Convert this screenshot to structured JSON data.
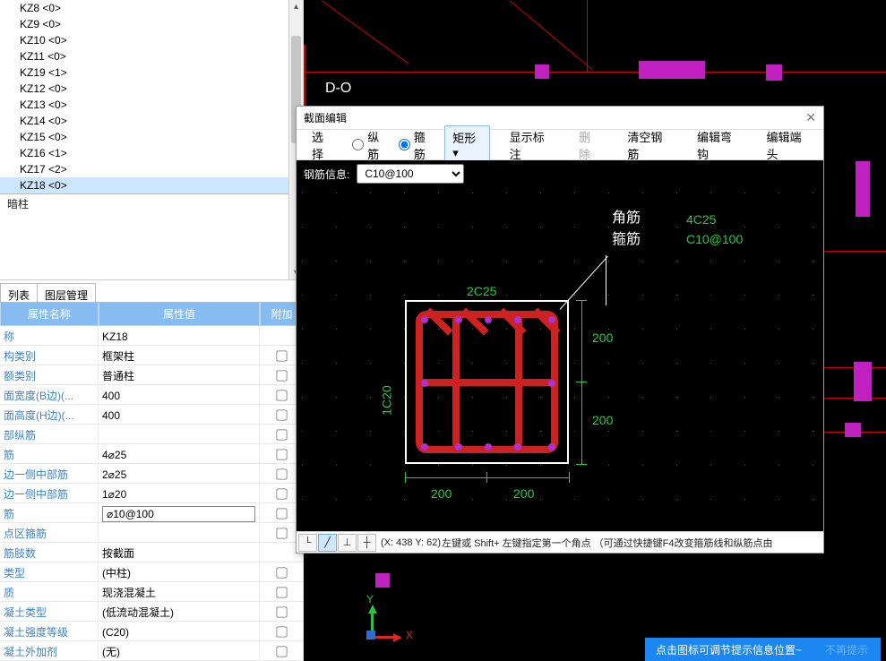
{
  "sidebar": {
    "items": [
      {
        "label": "KZ8  <0>"
      },
      {
        "label": "KZ9  <0>"
      },
      {
        "label": "KZ10  <0>"
      },
      {
        "label": "KZ11  <0>"
      },
      {
        "label": "KZ19  <1>"
      },
      {
        "label": "KZ12  <0>"
      },
      {
        "label": "KZ13  <0>"
      },
      {
        "label": "KZ14  <0>"
      },
      {
        "label": "KZ15  <0>"
      },
      {
        "label": "KZ16  <1>"
      },
      {
        "label": "KZ17  <2>"
      },
      {
        "label": "KZ18  <0>",
        "selected": true
      }
    ],
    "footer": "暗柱"
  },
  "tabs": {
    "t0": "列表",
    "t1": "图层管理"
  },
  "prop": {
    "head": {
      "c1": "属性名称",
      "c2": "属性值",
      "c3": "附加"
    },
    "rows": [
      {
        "n": "称",
        "v": "KZ18",
        "chk": false,
        "input": false
      },
      {
        "n": "构类别",
        "v": "框架柱",
        "chk": true
      },
      {
        "n": "额类别",
        "v": "普通柱",
        "chk": true
      },
      {
        "n": "面宽度(B边)(...",
        "v": "400",
        "chk": true
      },
      {
        "n": "面高度(H边)(...",
        "v": "400",
        "chk": true
      },
      {
        "n": "部纵筋",
        "v": "",
        "chk": true
      },
      {
        "n": "筋",
        "v": "4⌀25",
        "chk": true
      },
      {
        "n": "边一侧中部筋",
        "v": "2⌀25",
        "chk": true
      },
      {
        "n": "边一侧中部筋",
        "v": "1⌀20",
        "chk": true
      },
      {
        "n": "筋",
        "v": "⌀10@100",
        "chk": true,
        "input": true
      },
      {
        "n": "点区箍筋",
        "v": "",
        "chk": true
      },
      {
        "n": "筋肢数",
        "v": "按截面",
        "chk": false,
        "input": false
      },
      {
        "n": "类型",
        "v": "(中柱)",
        "chk": true
      },
      {
        "n": "质",
        "v": "现浇混凝土",
        "chk": true
      },
      {
        "n": "凝土类型",
        "v": "(低流动混凝土)",
        "chk": true
      },
      {
        "n": "凝土强度等级",
        "v": "(C20)",
        "chk": true
      },
      {
        "n": "凝土外加剂",
        "v": "(无)",
        "chk": true
      }
    ]
  },
  "canvas": {
    "axis_marker": "D-O",
    "axis_y": "Y",
    "axis_x": "X"
  },
  "tip": {
    "msg": "点击图标可调节提示信息位置~",
    "dismiss": "不再提示"
  },
  "modal": {
    "title": "截面编辑",
    "toolbar": {
      "select": "选择",
      "zong": "纵筋",
      "gu": "箍筋",
      "shape": "矩形",
      "showlabel": "显示标注",
      "delete": "删除",
      "clear": "清空钢筋",
      "hook": "编辑弯钩",
      "end": "编辑端头"
    },
    "inforow": {
      "label": "钢筋信息:",
      "value": "C10@100"
    },
    "annot": {
      "corner": "角筋",
      "gu2": "箍筋",
      "code1": "4C25",
      "code2": "C10@100",
      "top_dim": "2C25",
      "left_dim": "1C20",
      "right_dim1": "200",
      "right_dim2": "200",
      "bot_dim1": "200",
      "bot_dim2": "200"
    },
    "status": {
      "coord": "(X: 438 Y: 62)",
      "hint": "左键或 Shift+ 左键指定第一个角点 （可通过快捷键F4改变箍筋线和纵筋点由"
    }
  },
  "chart_data": {
    "type": "diagram",
    "subject": "column-section",
    "width_mm": 400,
    "height_mm": 400,
    "corner_bars": "4C25",
    "B_side_mid_bars": "2C25",
    "H_side_mid_bars": "1C20",
    "stirrup": "C10@100",
    "dims": {
      "x": [
        200,
        200
      ],
      "y": [
        200,
        200
      ]
    }
  }
}
